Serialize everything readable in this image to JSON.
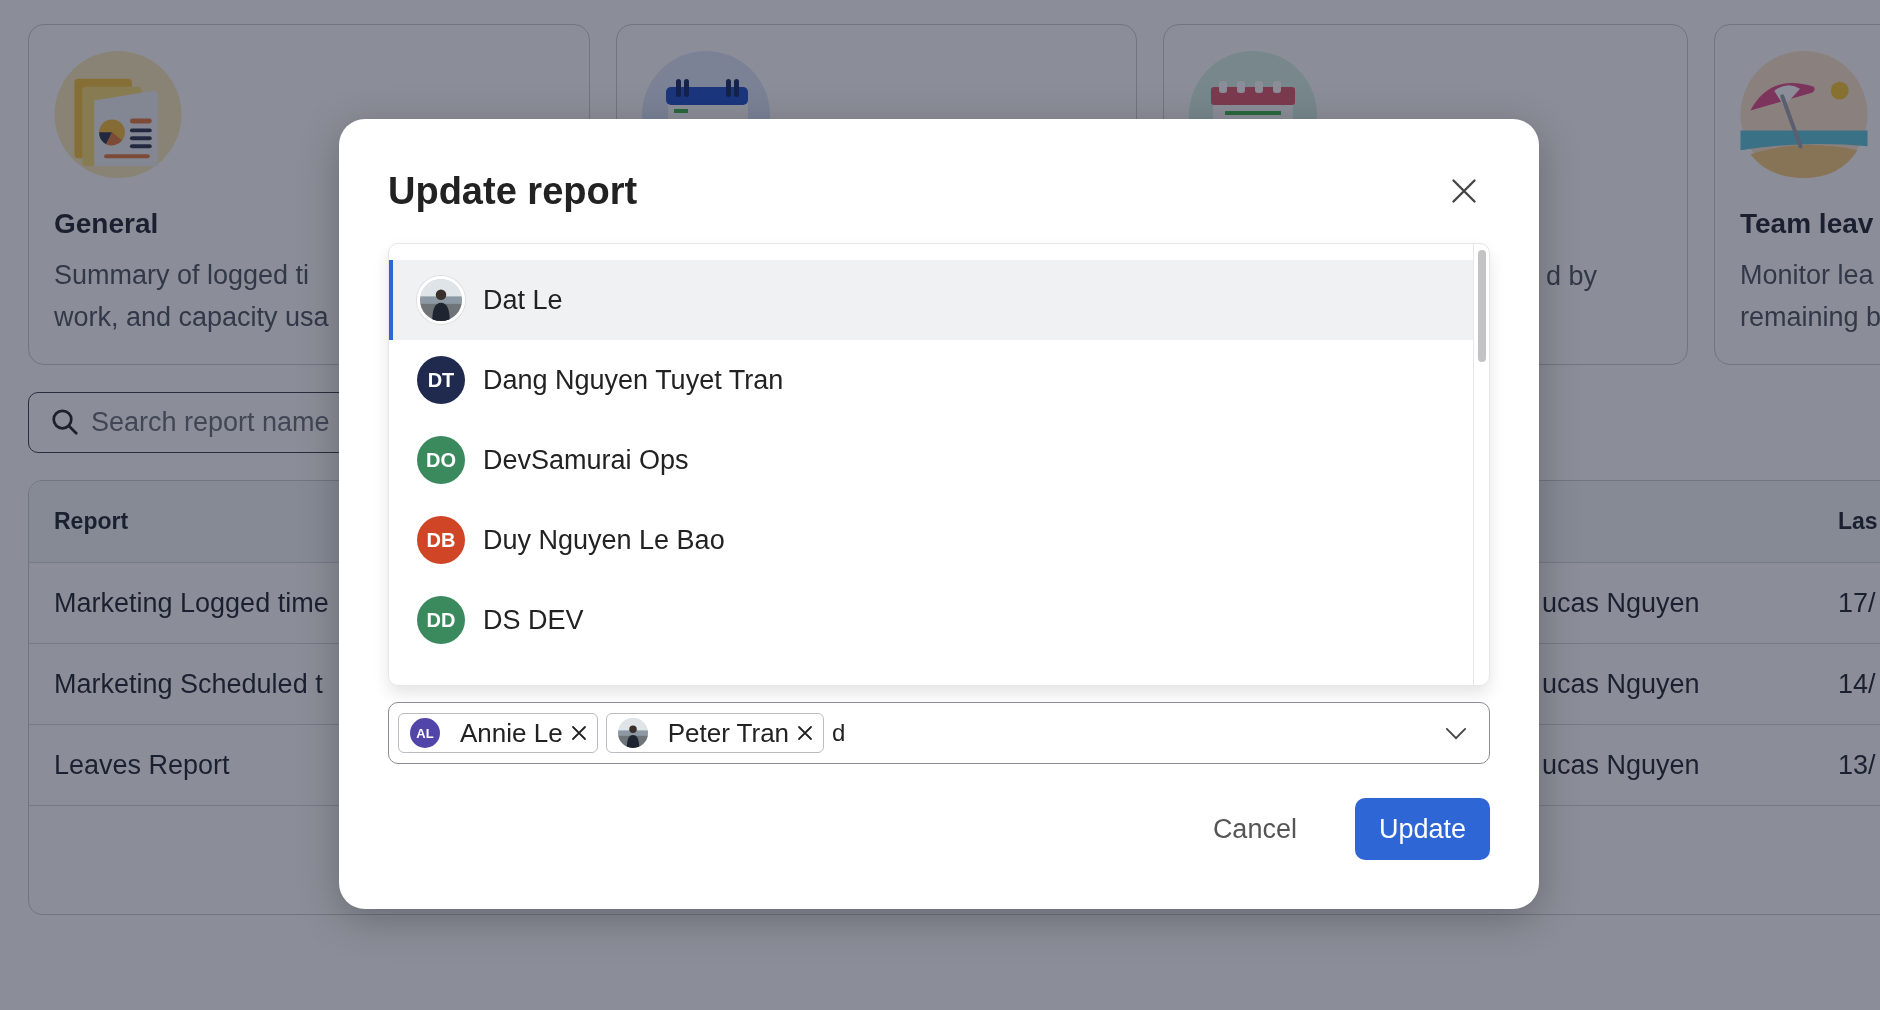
{
  "page": {
    "cards": [
      {
        "kind": "report",
        "title": "General",
        "description": "Summary of logged ti\nwork, and capacity usa"
      },
      {
        "kind": "calendar-blue"
      },
      {
        "kind": "calendar-red",
        "description": "d by"
      },
      {
        "kind": "beach",
        "title": "Team leav",
        "description": "Monitor lea\nremaining b"
      }
    ],
    "search": {
      "placeholder": "Search report name"
    },
    "table": {
      "header": {
        "report": "Report",
        "column_3": "Las"
      },
      "rows": [
        {
          "report": "Marketing Logged time",
          "column_2": "ucas Nguyen",
          "column_3": "17/"
        },
        {
          "report": "Marketing Scheduled t",
          "column_2": "ucas Nguyen",
          "column_3": "14/"
        },
        {
          "report": "Leaves Report",
          "column_2": "ucas Nguyen",
          "column_3": "13/"
        }
      ]
    }
  },
  "modal": {
    "title": "Update report",
    "options": [
      {
        "name": "Dat Le",
        "selected": true
      },
      {
        "name": "Dang Nguyen Tuyet Tran",
        "kind": "initials",
        "initials": "DT",
        "color": "#1f2a4e",
        "selected": false
      },
      {
        "name": "DevSamurai Ops",
        "kind": "initials",
        "initials": "DO",
        "color": "#3b8a5e",
        "selected": false
      },
      {
        "name": "Duy Nguyen Le Bao",
        "kind": "initials",
        "initials": "DB",
        "color": "#cf4526",
        "selected": false
      },
      {
        "name": "DS DEV",
        "kind": "initials",
        "initials": "DD",
        "color": "#3b8a5e",
        "selected": false
      }
    ],
    "field": {
      "tags": [
        {
          "name": "Annie Le",
          "kind": "initials",
          "initials": "AL",
          "color": "#5245aa"
        },
        {
          "name": "Peter Tran"
        }
      ],
      "value": "d"
    },
    "buttons": [
      {
        "label": "Cancel",
        "kind": "secondary"
      },
      {
        "label": "Update",
        "kind": "primary"
      }
    ]
  }
}
